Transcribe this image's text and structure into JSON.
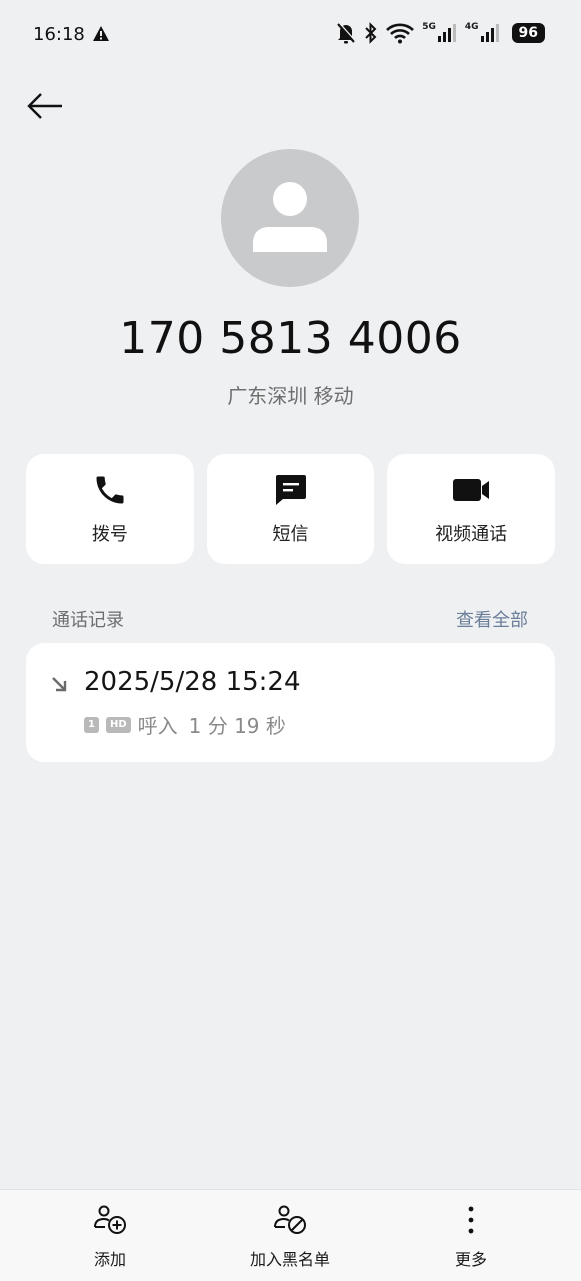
{
  "status_bar": {
    "time": "16:18",
    "signal1_label": "5G",
    "signal2_label": "4G",
    "battery": "96"
  },
  "contact": {
    "number": "170 5813 4006",
    "location": "广东深圳 移动"
  },
  "actions": {
    "dial_label": "拨号",
    "sms_label": "短信",
    "video_label": "视频通话"
  },
  "call_log": {
    "title": "通话记录",
    "view_all": "查看全部",
    "entry": {
      "datetime": "2025/5/28 15:24",
      "sim": "1",
      "hd": "HD",
      "direction": "呼入",
      "duration": "1 分 19 秒"
    }
  },
  "bottom_bar": {
    "add_label": "添加",
    "block_label": "加入黑名单",
    "more_label": "更多"
  }
}
